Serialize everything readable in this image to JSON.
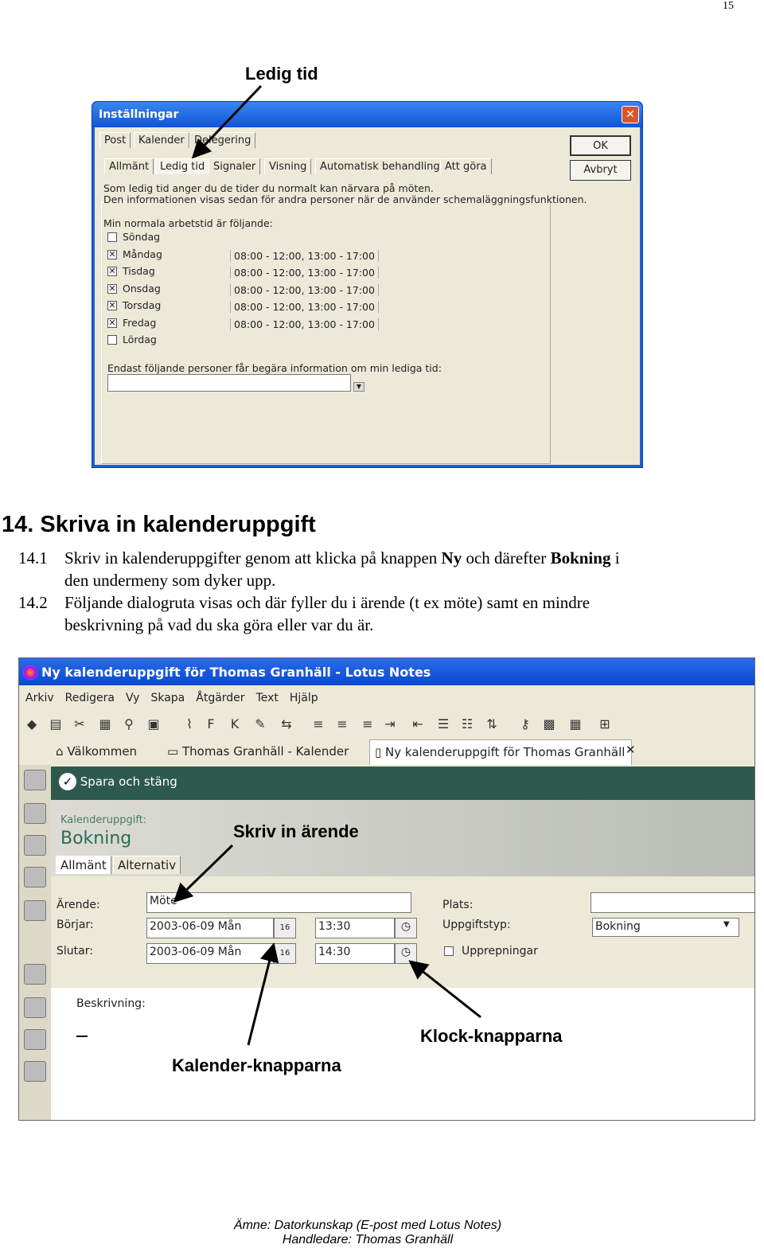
{
  "page_number": "15",
  "callouts": {
    "ledig_tid": "Ledig tid",
    "skriv_arende": "Skriv in ärende",
    "kalender": "Kalender-knapparna",
    "klock": "Klock-knapparna"
  },
  "dialog": {
    "title": "Inställningar",
    "top_tabs": [
      "Post",
      "Kalender",
      "Delegering"
    ],
    "sub_tabs": [
      "Allmänt",
      "Ledig tid",
      "Signaler",
      "Visning",
      "Automatisk behandling",
      "Att göra"
    ],
    "active_sub_tab": "Ledig tid",
    "ok": "OK",
    "cancel": "Avbryt",
    "intro1": "Som ledig tid anger du de tider du normalt kan närvara på möten.",
    "intro2": "Den informationen visas sedan för andra personer när de använder schemaläggningsfunktionen.",
    "worktime_label": "Min normala arbetstid är följande:",
    "days": [
      {
        "name": "Söndag",
        "checked": false,
        "hours": ""
      },
      {
        "name": "Måndag",
        "checked": true,
        "hours": "08:00 - 12:00, 13:00 - 17:00"
      },
      {
        "name": "Tisdag",
        "checked": true,
        "hours": "08:00 - 12:00, 13:00 - 17:00"
      },
      {
        "name": "Onsdag",
        "checked": true,
        "hours": "08:00 - 12:00, 13:00 - 17:00"
      },
      {
        "name": "Torsdag",
        "checked": true,
        "hours": "08:00 - 12:00, 13:00 - 17:00"
      },
      {
        "name": "Fredag",
        "checked": true,
        "hours": "08:00 - 12:00, 13:00 - 17:00"
      },
      {
        "name": "Lördag",
        "checked": false,
        "hours": ""
      }
    ],
    "persons_label": "Endast följande personer får begära information om min lediga tid:",
    "persons_value": ""
  },
  "section": {
    "heading": "14. Skriva in kalenderuppgift",
    "p1_num": "14.1",
    "p1_a": "Skriv in kalenderuppgifter genom att klicka på knappen ",
    "p1_b": "Ny",
    "p1_c": " och därefter ",
    "p1_d": "Bokning",
    "p1_e": " i",
    "p1_f": "den undermeny som dyker upp.",
    "p2_num": "14.2",
    "p2_a": "Följande dialogruta visas och där fyller du i ärende (t ex möte) samt en mindre",
    "p2_b": "beskrivning på vad du ska göra eller var du är."
  },
  "notes": {
    "title": "Ny kalenderuppgift för Thomas Granhäll - Lotus Notes",
    "menu": [
      "Arkiv",
      "Redigera",
      "Vy",
      "Skapa",
      "Åtgärder",
      "Text",
      "Hjälp"
    ],
    "toolbar_icons": [
      "properties-icon",
      "print-icon",
      "cut-icon",
      "copy-icon",
      "paste-icon",
      "find-icon",
      "attach-icon",
      "bold-icon",
      "italic-icon",
      "highlight-icon",
      "indent-icon",
      "align-left-icon",
      "align-center-icon",
      "align-right-icon",
      "indent-in-icon",
      "indent-out-icon",
      "bullets-icon",
      "numbers-icon",
      "sort-icon",
      "link-icon",
      "spellcheck-icon",
      "grid-icon",
      "table-icon"
    ],
    "toolbar_glyphs": [
      "◆",
      "▤",
      "✂",
      "▦",
      "⚲",
      "▣",
      "⌇",
      "F",
      "K",
      "✎",
      "⇆",
      "≡",
      "≡",
      "≡",
      "⇥",
      "⇤",
      "☰",
      "☷",
      "⇅",
      "⚷",
      "▩",
      "▦",
      "⊞"
    ],
    "tabs": [
      "Välkommen",
      "Thomas Granhäll - Kalender",
      "Ny kalenderuppgift för Thomas Granhäll"
    ],
    "save_close": "Spara och stäng",
    "form_type": "Kalenderuppgift:",
    "form_title": "Bokning",
    "form_tabs": [
      "Allmänt",
      "Alternativ"
    ],
    "arende_label": "Ärende:",
    "arende_value": "Möte",
    "borjar_label": "Börjar:",
    "borjar_date": "2003-06-09 Mån",
    "borjar_time": "13:30",
    "slutar_label": "Slutar:",
    "slutar_date": "2003-06-09 Mån",
    "slutar_time": "14:30",
    "cal_btn": "16",
    "plats_label": "Plats:",
    "plats_value": "",
    "typ_label": "Uppgiftstyp:",
    "typ_value": "Bokning",
    "repeat_label": "Upprepningar",
    "beskrivning_label": "Beskrivning:"
  },
  "footer": {
    "line1": "Ämne: Datorkunskap (E-post med Lotus Notes)",
    "line2": "Handledare: Thomas Granhäll"
  }
}
